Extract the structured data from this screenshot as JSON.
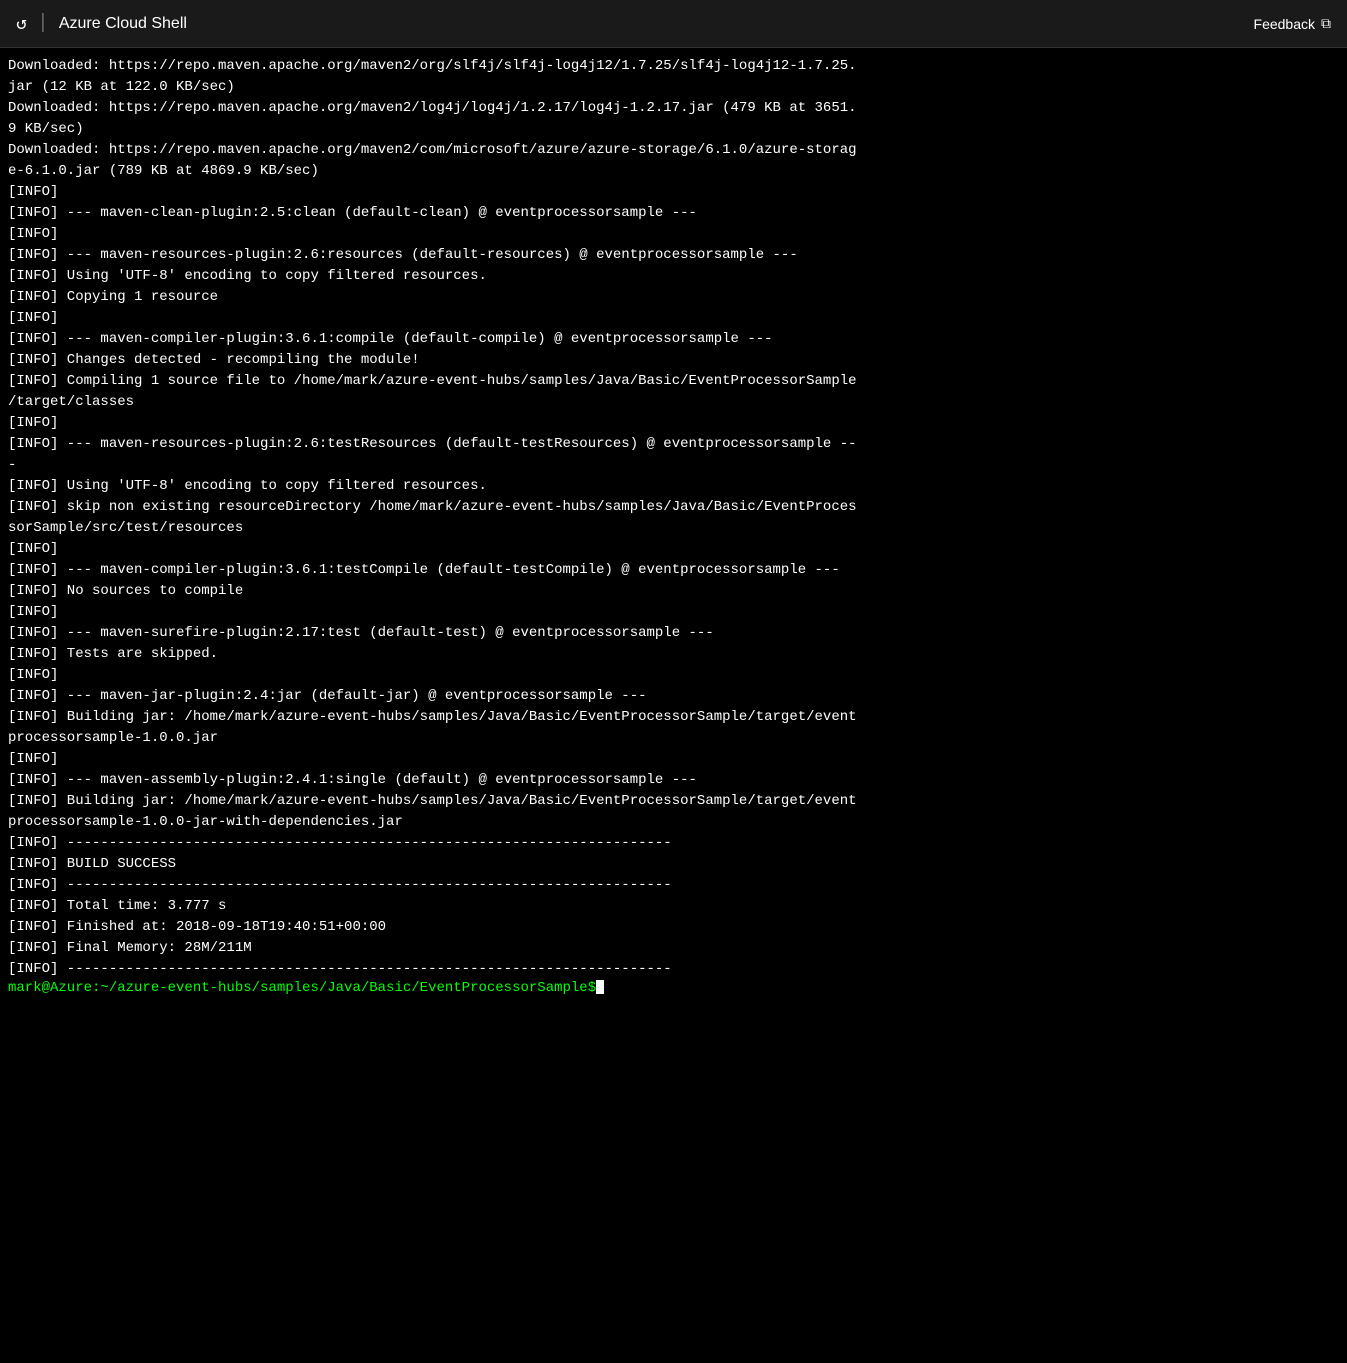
{
  "titlebar": {
    "title": "Azure Cloud Shell",
    "feedback_label": "Feedback",
    "refresh_icon": "↺",
    "divider": "|",
    "external_link_icon": "⧉"
  },
  "terminal": {
    "lines": [
      "Downloaded: https://repo.maven.apache.org/maven2/org/slf4j/slf4j-log4j12/1.7.25/slf4j-log4j12-1.7.25.",
      "jar (12 KB at 122.0 KB/sec)",
      "Downloaded: https://repo.maven.apache.org/maven2/log4j/log4j/1.2.17/log4j-1.2.17.jar (479 KB at 3651.",
      "9 KB/sec)",
      "Downloaded: https://repo.maven.apache.org/maven2/com/microsoft/azure/azure-storage/6.1.0/azure-storag",
      "e-6.1.0.jar (789 KB at 4869.9 KB/sec)",
      "[INFO]",
      "[INFO] --- maven-clean-plugin:2.5:clean (default-clean) @ eventprocessorsample ---",
      "[INFO]",
      "[INFO] --- maven-resources-plugin:2.6:resources (default-resources) @ eventprocessorsample ---",
      "[INFO] Using 'UTF-8' encoding to copy filtered resources.",
      "[INFO] Copying 1 resource",
      "[INFO]",
      "[INFO] --- maven-compiler-plugin:3.6.1:compile (default-compile) @ eventprocessorsample ---",
      "[INFO] Changes detected - recompiling the module!",
      "[INFO] Compiling 1 source file to /home/mark/azure-event-hubs/samples/Java/Basic/EventProcessorSample",
      "/target/classes",
      "[INFO]",
      "[INFO] --- maven-resources-plugin:2.6:testResources (default-testResources) @ eventprocessorsample --",
      "-",
      "[INFO] Using 'UTF-8' encoding to copy filtered resources.",
      "[INFO] skip non existing resourceDirectory /home/mark/azure-event-hubs/samples/Java/Basic/EventProces",
      "sorSample/src/test/resources",
      "[INFO]",
      "[INFO] --- maven-compiler-plugin:3.6.1:testCompile (default-testCompile) @ eventprocessorsample ---",
      "[INFO] No sources to compile",
      "[INFO]",
      "[INFO] --- maven-surefire-plugin:2.17:test (default-test) @ eventprocessorsample ---",
      "[INFO] Tests are skipped.",
      "[INFO]",
      "[INFO] --- maven-jar-plugin:2.4:jar (default-jar) @ eventprocessorsample ---",
      "[INFO] Building jar: /home/mark/azure-event-hubs/samples/Java/Basic/EventProcessorSample/target/event",
      "processorsample-1.0.0.jar",
      "[INFO]",
      "[INFO] --- maven-assembly-plugin:2.4.1:single (default) @ eventprocessorsample ---",
      "[INFO] Building jar: /home/mark/azure-event-hubs/samples/Java/Basic/EventProcessorSample/target/event",
      "processorsample-1.0.0-jar-with-dependencies.jar",
      "[INFO] ------------------------------------------------------------------------",
      "[INFO] BUILD SUCCESS",
      "[INFO] ------------------------------------------------------------------------",
      "[INFO] Total time: 3.777 s",
      "[INFO] Finished at: 2018-09-18T19:40:51+00:00",
      "[INFO] Final Memory: 28M/211M",
      "[INFO] ------------------------------------------------------------------------"
    ],
    "prompt": "mark@Azure:~/azure-event-hubs/samples/Java/Basic/EventProcessorSample$"
  }
}
